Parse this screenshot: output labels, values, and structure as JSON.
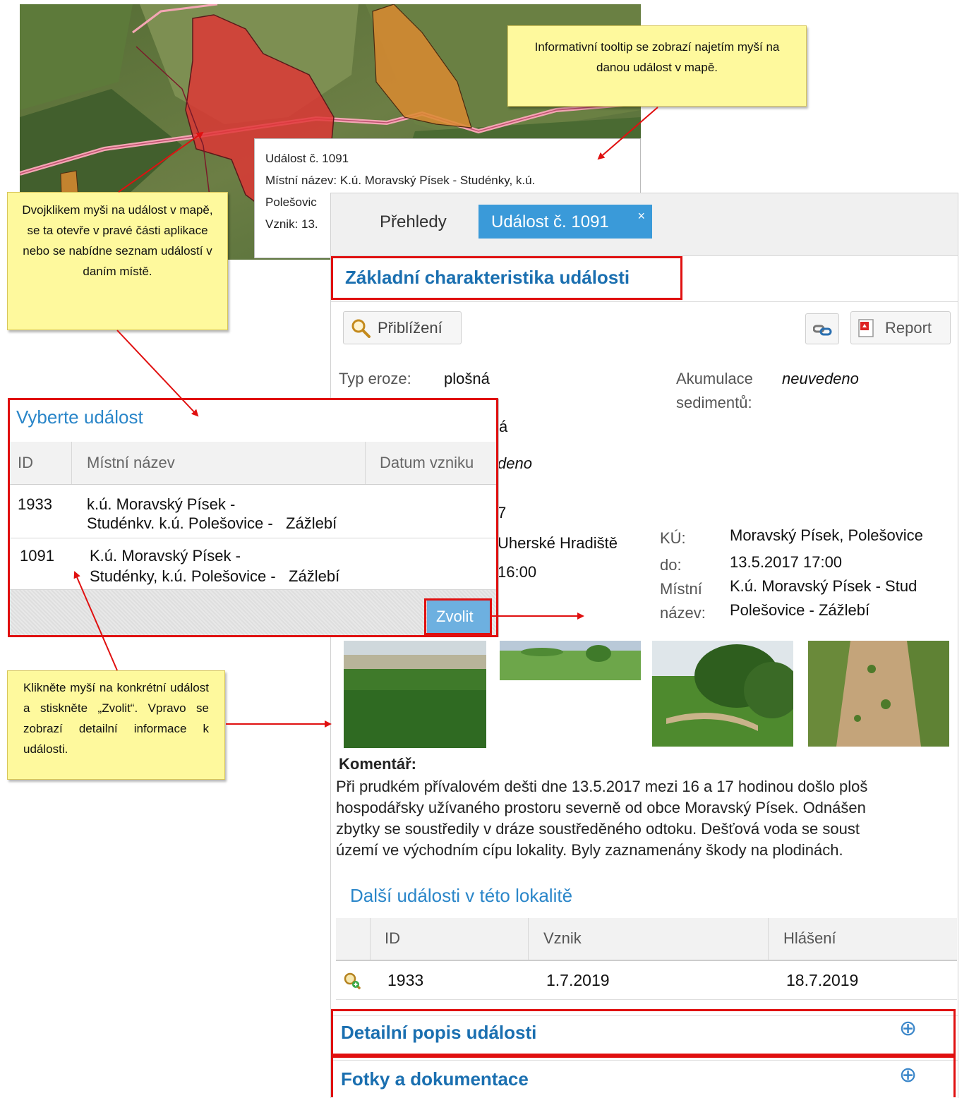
{
  "map_tooltip": {
    "line1": "Událost č. 1091",
    "line2": "Místní název: K.ú. Moravský Písek - Studénky, k.ú.",
    "line3": "Polešovic",
    "line4": "Vznik: 13."
  },
  "callouts": {
    "tooltip_note": "Informativní tooltip se zobrazí najetím myší na danou událost v mapě.",
    "doubleclick_note": "Dvojklikem myši na událost v mapě, se ta otevře v pravé části aplikace nebo se nabídne seznam událostí v daním místě.",
    "choose_note": "Klikněte myší na konkrétní událost a stiskněte „Zvolit“. Vpravo se zobrazí detailní informace k události."
  },
  "panel": {
    "tabs": [
      "Přehledy",
      "Událost č. 1091"
    ],
    "tab_close": "×",
    "section_title": "Základní charakteristika události",
    "zoom_label": "Přiblížení",
    "report_label": "Report",
    "fields": {
      "erosion_label": "Typ eroze:",
      "erosion_value": "plošná",
      "erosion_value2": "á",
      "accumulation_label_1": "Akumulace",
      "accumulation_label_2": "sedimentů:",
      "accumulation_value": "neuvedeno",
      "hidden_value": "deno",
      "partial_7": "7",
      "district_value": "Uherské Hradiště",
      "time_value": "16:00",
      "ku_label": "KÚ:",
      "ku_value": "Moravský Písek, Polešovice",
      "do_label": "do:",
      "do_value": "13.5.2017 17:00",
      "place_label_1": "Místní",
      "place_label_2": "název:",
      "place_value_1": "K.ú. Moravský Písek - Stud",
      "place_value_2": "Polešovice - Zážlebí"
    },
    "comment_heading": "Komentář:",
    "comment_lines": [
      "Při prudkém přívalovém dešti dne 13.5.2017 mezi 16 a 17 hodinou došlo ploš",
      "hospodářsky užívaného prostoru severně od obce Moravský Písek. Odnášen",
      "zbytky se soustředily v dráze soustředěného odtoku. Dešťová voda se soust",
      "území ve východním cípu lokality. Byly zaznamenány škody na plodinách."
    ],
    "other_events": {
      "heading": "Další události v této lokalitě",
      "columns": [
        "ID",
        "Vznik",
        "Hlášení"
      ],
      "rows": [
        {
          "id": "1933",
          "vznik": "1.7.2019",
          "hlaseni": "18.7.2019"
        }
      ]
    },
    "accordion": [
      "Detailní popis události",
      "Fotky a dokumentace"
    ],
    "accordion_icon": "⊕"
  },
  "dialog": {
    "title": "Vyberte událost",
    "columns": [
      "ID",
      "Místní název",
      "Datum vzniku"
    ],
    "rows": [
      {
        "id": "1933",
        "name_1": "k.ú. Moravský Písek -",
        "name_2": "Studénkv. k.ú. Polešovice -   Zážlebí"
      },
      {
        "id": "1091",
        "name_1": "K.ú. Moravský Písek -",
        "name_2": "Studénky, k.ú. Polešovice -   Zážlebí"
      }
    ],
    "choose_button": "Zvolit"
  },
  "colors": {
    "accent": "#3a9ad9",
    "highlight_frame": "#e01010",
    "callout": "#fef99d",
    "title_blue": "#1a6fb0"
  },
  "icons": [
    "magnifier-icon",
    "link-icon",
    "pdf-icon",
    "zoom-to-icon",
    "plus-circle-icon",
    "close-icon"
  ]
}
